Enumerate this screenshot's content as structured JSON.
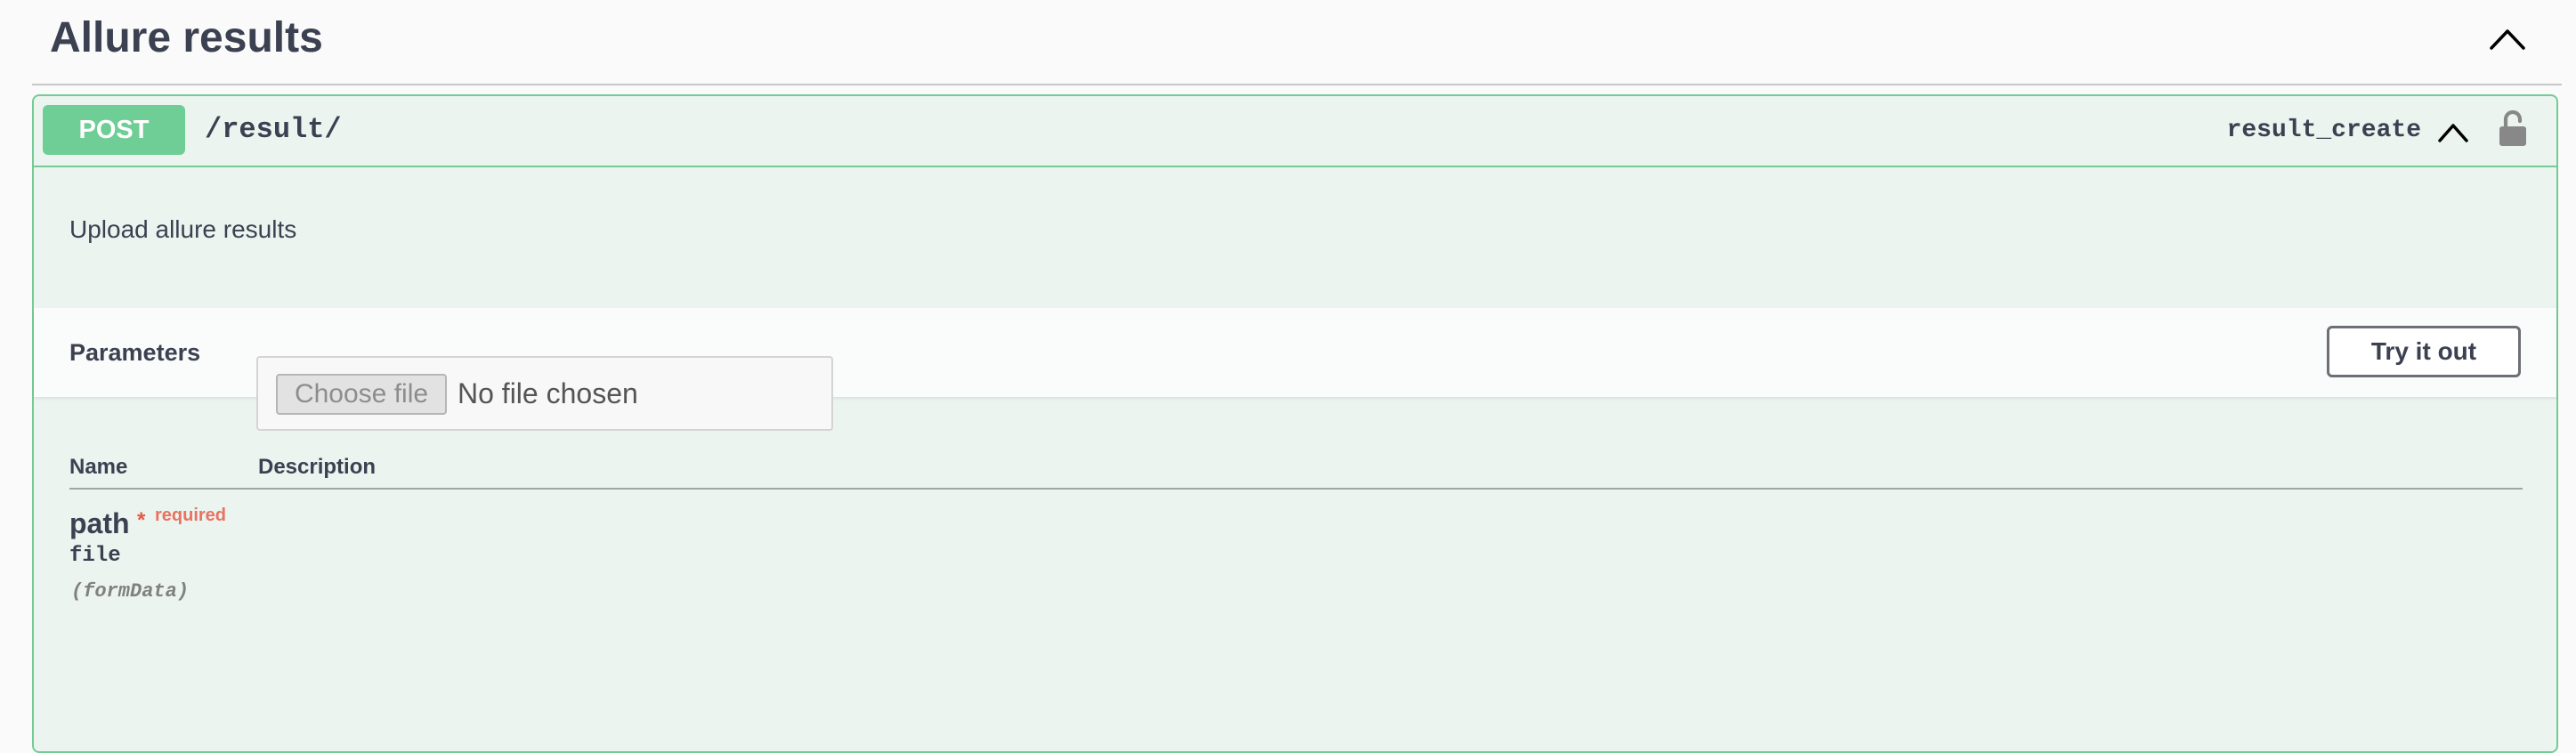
{
  "section": {
    "title": "Allure results"
  },
  "operation": {
    "method": "POST",
    "path": "/result/",
    "operation_id": "result_create",
    "description": "Upload allure results",
    "method_color": "#6fce95",
    "border_color": "#75cb94",
    "background_color": "#ebf4ef"
  },
  "parameters": {
    "title": "Parameters",
    "try_button_label": "Try it out",
    "columns": [
      "Name",
      "Description"
    ],
    "items": [
      {
        "name": "path",
        "required_marker": "*",
        "required_label": "required",
        "type": "file",
        "location": "(formData)",
        "file_button_label": "Choose file",
        "file_status": "No file chosen"
      }
    ]
  },
  "icons": {
    "section_collapse": "chevron-up-icon",
    "operation_collapse": "chevron-up-icon",
    "lock": "unlocked-padlock-icon"
  }
}
